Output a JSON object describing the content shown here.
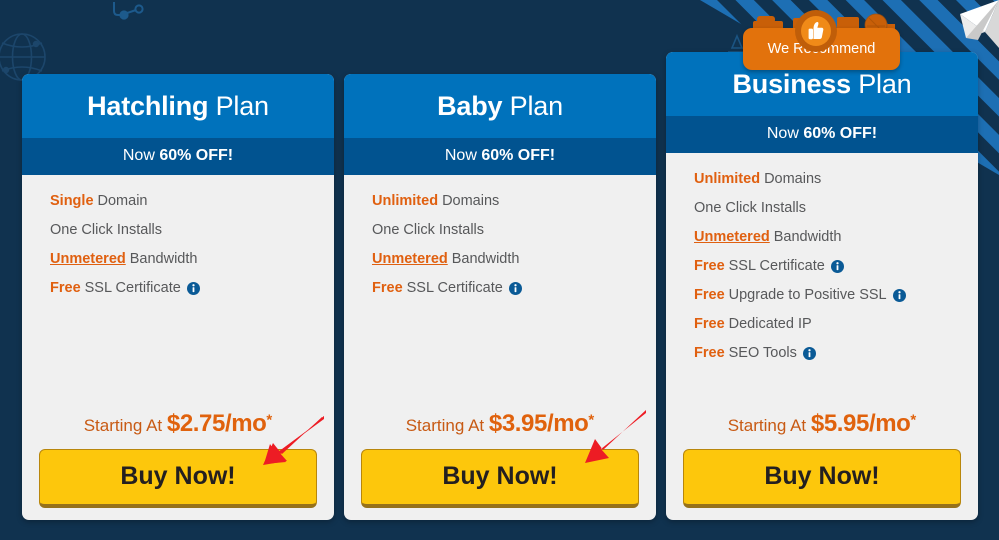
{
  "page": {
    "background_color": "#10324f",
    "card_body_color": "#f0f0f0",
    "header_blue": "#0072bc",
    "promo_blue": "#015390",
    "accent_orange": "#e06010",
    "button_yellow": "#fdc70c",
    "annotation_red": "#ed1c24"
  },
  "recommend_badge": {
    "label": "We Recommend",
    "icon": "thumbs-up-icon"
  },
  "plans": [
    {
      "name": "Hatchling",
      "plan_word": "Plan",
      "promo_prefix": "Now ",
      "promo_strong": "60% OFF!",
      "features": [
        {
          "highlight": "Single",
          "underline": false,
          "text": "Domain",
          "info": false
        },
        {
          "highlight": "",
          "underline": false,
          "text": "One Click Installs",
          "info": false
        },
        {
          "highlight": "Unmetered",
          "underline": true,
          "text": "Bandwidth",
          "info": false
        },
        {
          "highlight": "Free",
          "underline": false,
          "text": "SSL Certificate",
          "info": true
        }
      ],
      "price_prefix": "Starting At ",
      "price": "$2.75/mo",
      "price_star": "*",
      "buy_label": "Buy Now!"
    },
    {
      "name": "Baby",
      "plan_word": "Plan",
      "promo_prefix": "Now ",
      "promo_strong": "60% OFF!",
      "features": [
        {
          "highlight": "Unlimited",
          "underline": false,
          "text": "Domains",
          "info": false
        },
        {
          "highlight": "",
          "underline": false,
          "text": "One Click Installs",
          "info": false
        },
        {
          "highlight": "Unmetered",
          "underline": true,
          "text": "Bandwidth",
          "info": false
        },
        {
          "highlight": "Free",
          "underline": false,
          "text": "SSL Certificate",
          "info": true
        }
      ],
      "price_prefix": "Starting At ",
      "price": "$3.95/mo",
      "price_star": "*",
      "buy_label": "Buy Now!"
    },
    {
      "name": "Business",
      "plan_word": "Plan",
      "promo_prefix": "Now ",
      "promo_strong": "60% OFF!",
      "features": [
        {
          "highlight": "Unlimited",
          "underline": false,
          "text": "Domains",
          "info": false
        },
        {
          "highlight": "",
          "underline": false,
          "text": "One Click Installs",
          "info": false
        },
        {
          "highlight": "Unmetered",
          "underline": true,
          "text": "Bandwidth",
          "info": false
        },
        {
          "highlight": "Free",
          "underline": false,
          "text": "SSL Certificate",
          "info": true
        },
        {
          "highlight": "Free",
          "underline": false,
          "text": "Upgrade to Positive SSL",
          "info": true
        },
        {
          "highlight": "Free",
          "underline": false,
          "text": "Dedicated IP",
          "info": false
        },
        {
          "highlight": "Free",
          "underline": false,
          "text": "SEO Tools",
          "info": true
        }
      ],
      "price_prefix": "Starting At ",
      "price": "$5.95/mo",
      "price_star": "*",
      "buy_label": "Buy Now!"
    }
  ],
  "decorations": [
    {
      "name": "globe-wireframe-icon",
      "position": "top-left"
    },
    {
      "name": "node-connector-icon",
      "position": "top-center-left"
    },
    {
      "name": "diagonal-stripes",
      "position": "top-right"
    },
    {
      "name": "paper-airplane-icon",
      "position": "top-right-corner"
    }
  ],
  "annotations": [
    {
      "name": "red-arrow-to-hatchling-buy",
      "target": "buy-now-hatchling"
    },
    {
      "name": "red-arrow-to-baby-buy",
      "target": "buy-now-baby"
    }
  ]
}
